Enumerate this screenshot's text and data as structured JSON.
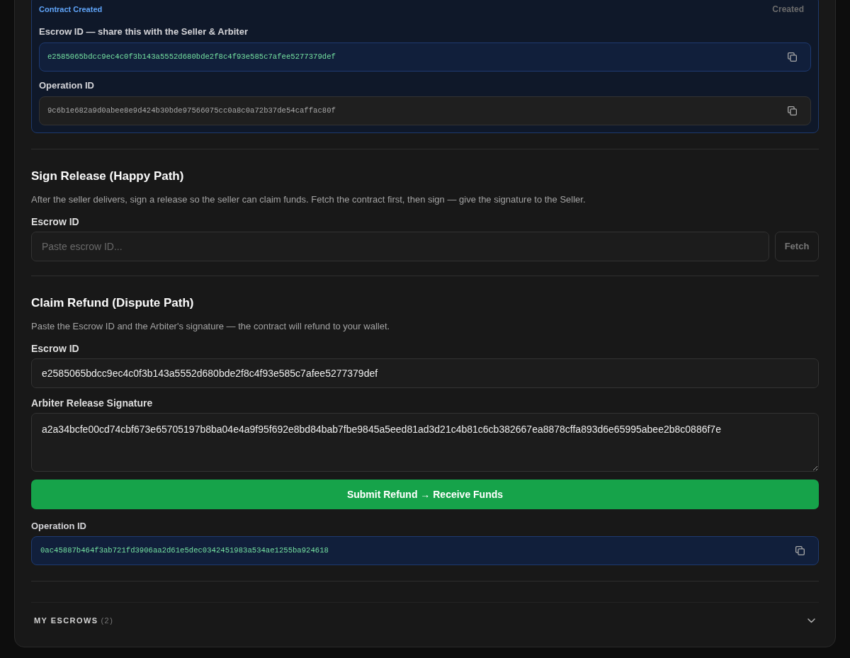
{
  "result": {
    "title": "Contract Created",
    "status": "Created",
    "fields": [
      {
        "label": "Escrow ID — share this with the Seller & Arbiter",
        "value": "e2585065bdcc9ec4c0f3b143a5552d680bde2f8c4f93e585c7afee5277379def",
        "highlight": true
      },
      {
        "label": "Operation ID",
        "value": "9c6b1e682a9d0abee8e9d424b30bde97566075cc0a8c0a72b37de54caffac80f",
        "highlight": false
      }
    ]
  },
  "sections": [
    {
      "title": "Sign Release (Happy Path)",
      "description": "After the seller delivers, sign a release so the seller can claim funds. Fetch the contract first, then sign — give the signature to the Seller.",
      "fields": [
        {
          "kind": "input",
          "label": "Escrow ID",
          "placeholder": "Paste escrow ID...",
          "button": {
            "label": "Fetch",
            "disabled": true
          }
        }
      ]
    },
    {
      "title": "Claim Refund (Dispute Path)",
      "description": "Paste the Escrow ID and the Arbiter's signature — the contract will refund to your wallet.",
      "fields": [
        {
          "kind": "input",
          "label": "Escrow ID",
          "value": "e2585065bdcc9ec4c0f3b143a5552d680bde2f8c4f93e585c7afee5277379def"
        },
        {
          "kind": "textarea",
          "label": "Arbiter Release Signature",
          "value": "a2a34bcfe00cd74cbf673e65705197b8ba04e4a9f95f692e8bd84bab7fbe9845a5eed81ad3d21c4b81c6cb382667ea8878cffa893d6e65995abee2b8c0886f7e"
        }
      ],
      "submit": "Submit Refund → Receive Funds",
      "output": {
        "label": "Operation ID",
        "value": "0ac45887b464f3ab721fd3906aa2d61e5dec0342451983a534ae1255ba924618",
        "highlight": true
      }
    }
  ],
  "my_escrows": {
    "title": "MY ESCROWS",
    "count": "(2)",
    "expanded": false
  }
}
